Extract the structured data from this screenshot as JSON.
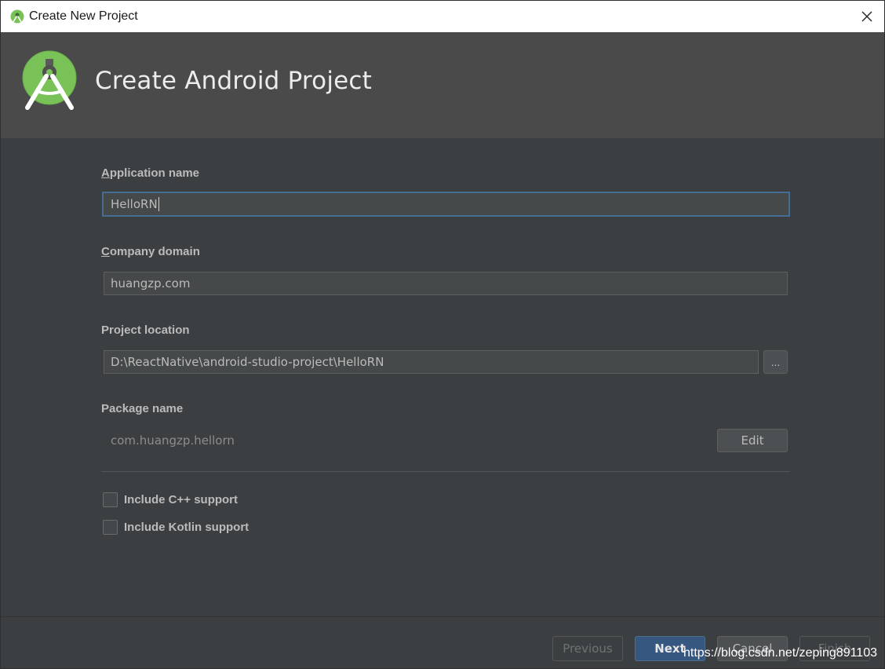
{
  "window": {
    "title": "Create New Project",
    "close_glyph": "✕"
  },
  "header": {
    "heading": "Create Android Project",
    "logo_icon": "android-studio-logo-icon"
  },
  "form": {
    "app_name": {
      "label_mnemonic": "A",
      "label_rest": "pplication name",
      "value": "HelloRN"
    },
    "company_domain": {
      "label_mnemonic": "C",
      "label_rest": "ompany domain",
      "value": "huangzp.com"
    },
    "project_location": {
      "label": "Project location",
      "value": "D:\\ReactNative\\android-studio-project\\HelloRN",
      "browse_label": "..."
    },
    "package_name": {
      "label": "Package name",
      "value": "com.huangzp.hellorn",
      "edit_label": "Edit"
    },
    "include_cpp": {
      "label": "Include C++ support",
      "checked": false
    },
    "include_kotlin": {
      "label": "Include Kotlin support",
      "checked": false
    }
  },
  "footer": {
    "previous_label": "Previous",
    "next_label": "Next",
    "cancel_label": "Cancel",
    "finish_label": "Finish"
  },
  "watermark": "https://blog.csdn.net/zeping891103",
  "colors": {
    "background": "#3c3f41",
    "header": "#4a4a4a",
    "accent_blue": "#365880",
    "focus_border": "#466d94",
    "android_green": "#78c257"
  }
}
